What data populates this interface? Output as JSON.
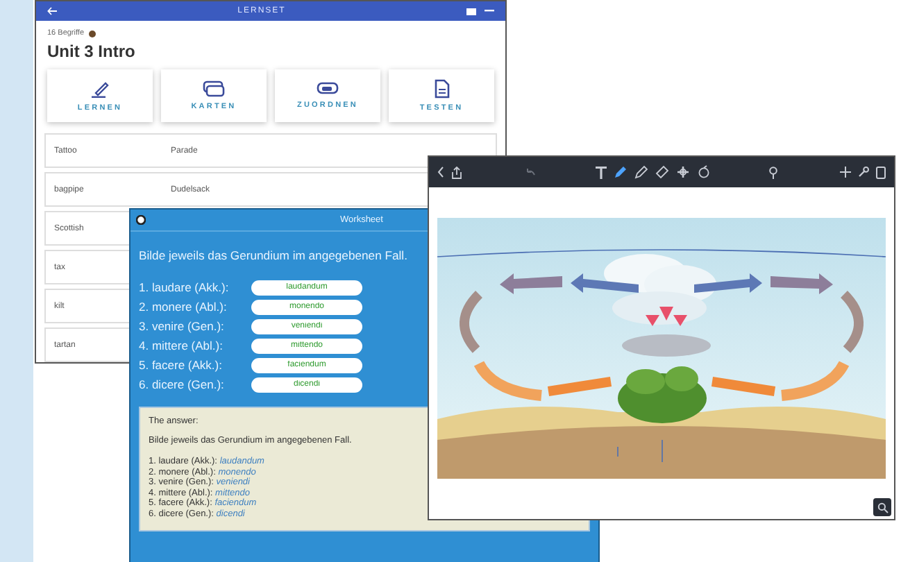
{
  "vocab_app": {
    "title": "LERNSET",
    "breadcrumb": "16 Begriffe",
    "heading": "Unit 3 Intro",
    "modes": [
      {
        "label": "LERNEN",
        "kind": "pen"
      },
      {
        "label": "KARTEN",
        "kind": "cards"
      },
      {
        "label": "ZUORDNEN",
        "kind": "match"
      },
      {
        "label": "TESTEN",
        "kind": "document"
      }
    ],
    "terms": [
      {
        "term": "Tattoo",
        "definition": "Parade"
      },
      {
        "term": "bagpipe",
        "definition": "Dudelsack"
      },
      {
        "term": "Scottish"
      },
      {
        "term": "tax"
      },
      {
        "term": "kilt"
      },
      {
        "term": "tartan"
      }
    ]
  },
  "worksheet": {
    "title": "Worksheet",
    "instruction": "Bilde jeweils das Gerundium im angegebenen Fall.",
    "items": [
      {
        "prompt": "1. laudare (Akk.):",
        "value": "laudandum"
      },
      {
        "prompt": "2. monere (Abl.):",
        "value": "monendo"
      },
      {
        "prompt": "3. venire (Gen.):",
        "value": "veniendi"
      },
      {
        "prompt": "4. mittere (Abl.):",
        "value": "mittendo"
      },
      {
        "prompt": "5. facere (Akk.):",
        "value": "faciendum"
      },
      {
        "prompt": "6. dicere (Gen.):",
        "value": "dicendi"
      }
    ],
    "answer": {
      "heading": "The answer:",
      "instruction": "Bilde jeweils das Gerundium im angegebenen Fall.",
      "lines": [
        {
          "prompt": "1. laudare (Akk.):",
          "answer": "laudandum"
        },
        {
          "prompt": "2. monere (Abl.):",
          "answer": "monendo"
        },
        {
          "prompt": "3. venire (Gen.):",
          "answer": "veniendi"
        },
        {
          "prompt": "4. mittere (Abl.):",
          "answer": "mittendo"
        },
        {
          "prompt": "5. facere (Akk.):",
          "answer": "faciendum"
        },
        {
          "prompt": "6. dicere (Gen.):",
          "answer": "dicendi"
        }
      ]
    }
  },
  "drawing_app": {
    "tools": [
      {
        "kind": "text",
        "selected": false
      },
      {
        "kind": "pen",
        "selected": true
      },
      {
        "kind": "pencil",
        "selected": false
      },
      {
        "kind": "eraser",
        "selected": false
      },
      {
        "kind": "shapes",
        "selected": false
      },
      {
        "kind": "lasso",
        "selected": false
      }
    ]
  }
}
